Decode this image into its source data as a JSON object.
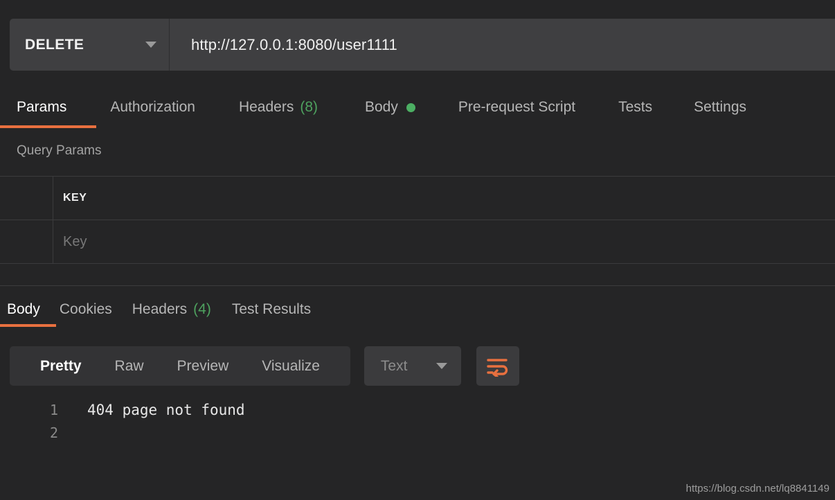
{
  "request": {
    "method": "DELETE",
    "url": "http://127.0.0.1:8080/user1111",
    "method_caret_icon": "chevron-down-icon",
    "tabs": [
      {
        "id": "params",
        "label": "Params",
        "active": true,
        "badge": "",
        "dot": false
      },
      {
        "id": "auth",
        "label": "Authorization",
        "active": false,
        "badge": "",
        "dot": false
      },
      {
        "id": "headers",
        "label": "Headers",
        "active": false,
        "badge": "(8)",
        "dot": false
      },
      {
        "id": "body",
        "label": "Body",
        "active": false,
        "badge": "",
        "dot": true
      },
      {
        "id": "prerequest",
        "label": "Pre-request Script",
        "active": false,
        "badge": "",
        "dot": false
      },
      {
        "id": "tests",
        "label": "Tests",
        "active": false,
        "badge": "",
        "dot": false
      },
      {
        "id": "settings",
        "label": "Settings",
        "active": false,
        "badge": "",
        "dot": false
      }
    ]
  },
  "query_params": {
    "section_title": "Query Params",
    "columns": [
      "KEY"
    ],
    "rows": [
      {
        "key_placeholder": "Key"
      }
    ]
  },
  "response": {
    "tabs": [
      {
        "id": "body",
        "label": "Body",
        "active": true,
        "badge": ""
      },
      {
        "id": "cookies",
        "label": "Cookies",
        "active": false,
        "badge": ""
      },
      {
        "id": "headers",
        "label": "Headers",
        "active": false,
        "badge": "(4)"
      },
      {
        "id": "testresults",
        "label": "Test Results",
        "active": false,
        "badge": ""
      }
    ],
    "viewer_modes": [
      {
        "id": "pretty",
        "label": "Pretty",
        "active": true
      },
      {
        "id": "raw",
        "label": "Raw",
        "active": false
      },
      {
        "id": "preview",
        "label": "Preview",
        "active": false
      },
      {
        "id": "visualize",
        "label": "Visualize",
        "active": false
      }
    ],
    "format_dropdown": {
      "value": "Text",
      "caret_icon": "chevron-down-icon"
    },
    "wrap_button": {
      "icon": "word-wrap-icon"
    },
    "body_lines": [
      {
        "number": "1",
        "text": "404 page not found"
      },
      {
        "number": "2",
        "text": ""
      }
    ]
  },
  "watermark": "https://blog.csdn.net/lq8841149",
  "colors": {
    "page_bg": "#252526",
    "panel_bg": "#3f3f41",
    "accent_orange": "#e8703f",
    "badge_green": "#4ea25f",
    "body_dot_green": "#4caf63",
    "border": "#3b3b3d",
    "text_primary": "#f0f0f0",
    "text_muted": "#b6b6b6"
  }
}
